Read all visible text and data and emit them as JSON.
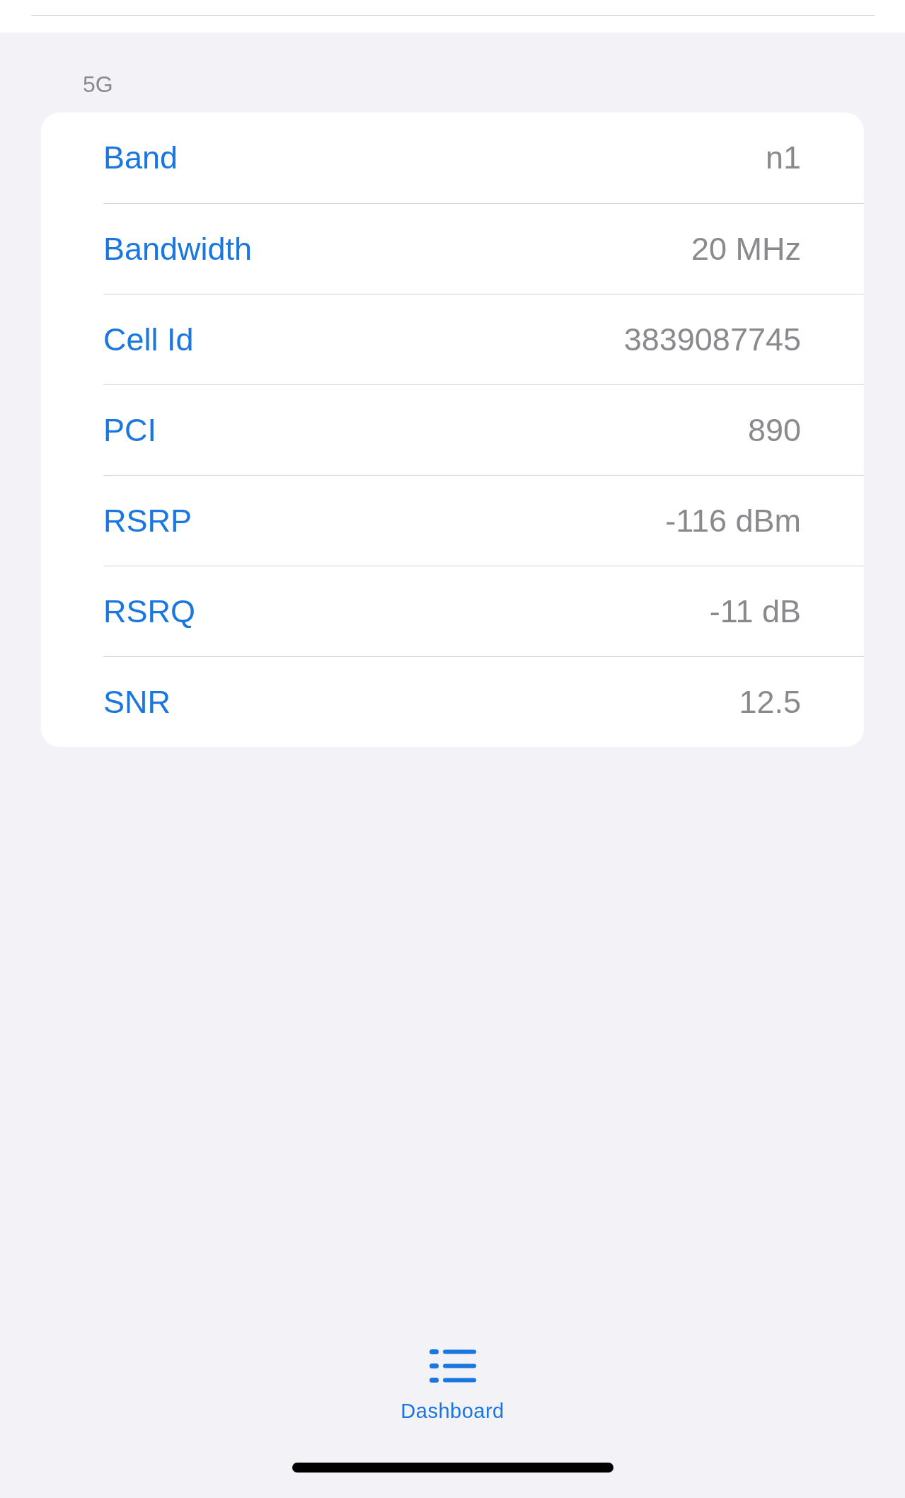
{
  "section": {
    "title": "5G",
    "rows": [
      {
        "label": "Band",
        "value": "n1"
      },
      {
        "label": "Bandwidth",
        "value": "20 MHz"
      },
      {
        "label": "Cell Id",
        "value": "3839087745"
      },
      {
        "label": "PCI",
        "value": "890"
      },
      {
        "label": "RSRP",
        "value": "-116 dBm"
      },
      {
        "label": "RSRQ",
        "value": "-11 dB"
      },
      {
        "label": "SNR",
        "value": "12.5"
      }
    ]
  },
  "tab_bar": {
    "tabs": [
      {
        "label": "Dashboard",
        "selected": true
      }
    ]
  }
}
